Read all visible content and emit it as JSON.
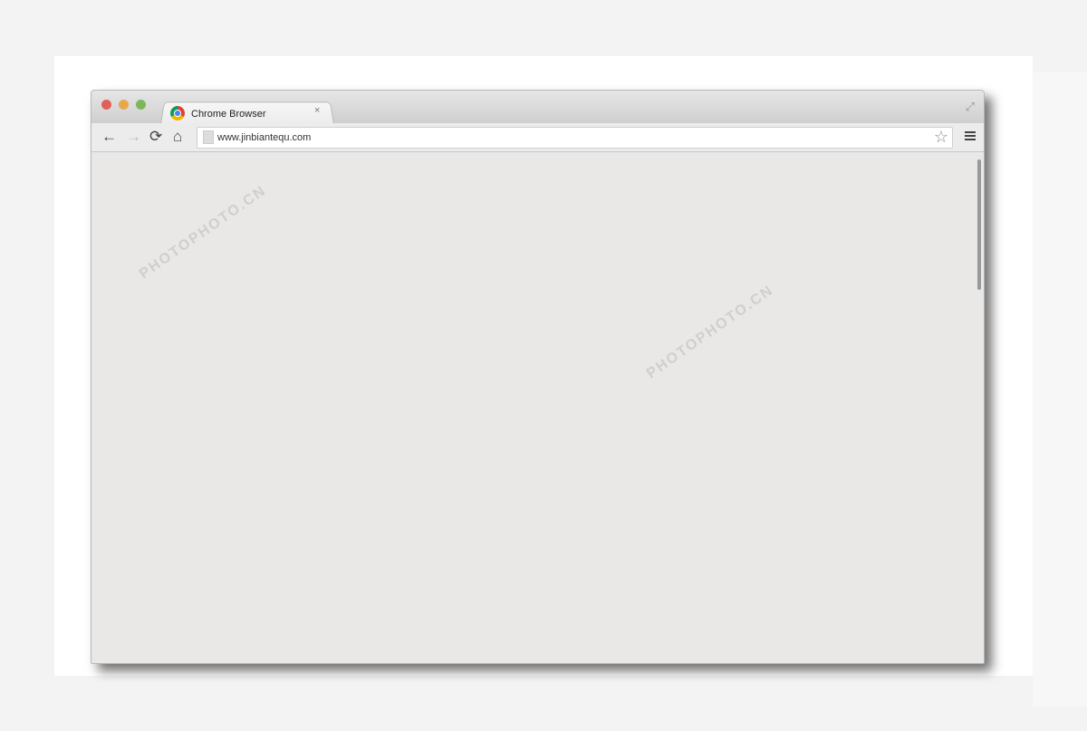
{
  "window": {
    "tab_title": "Chrome Browser",
    "tab_close": "×",
    "url": "www.jinbiantequ.com",
    "icons": [
      "close-light",
      "minimize-light",
      "zoom-light",
      "chrome-icon",
      "fullscreen-icon",
      "back-icon",
      "forward-icon",
      "reload-icon",
      "home-icon",
      "page-icon",
      "star-icon",
      "menu-icon"
    ],
    "traffic_colors": [
      "#e0605a",
      "#e8a84a",
      "#7ab85a"
    ]
  },
  "toolbar": {
    "back": "←",
    "forward": "→",
    "reload": "⟳",
    "home": "⌂",
    "star": "☆",
    "resize": "⤢"
  },
  "watermark": "PHOTOPHOTO.CN"
}
